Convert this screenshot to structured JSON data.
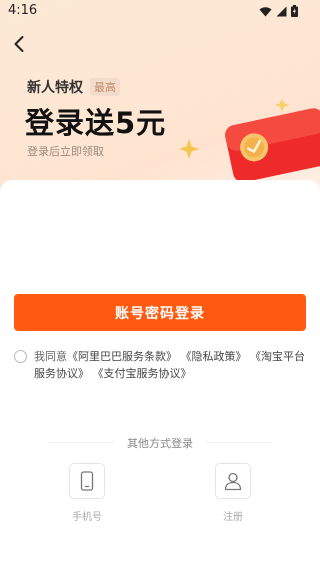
{
  "status_bar": {
    "time": "4:16",
    "icons": [
      "wifi-icon",
      "signal-icon",
      "battery-icon"
    ]
  },
  "header": {
    "back_icon": "chevron-left-icon"
  },
  "promo": {
    "subtitle": "新人特权",
    "badge": "最高",
    "title": "登录送5元",
    "hint": "登录后立即领取",
    "image": "red-packet-icon"
  },
  "login": {
    "button_label": "账号密码登录",
    "color": "#ff5a10"
  },
  "agreement": {
    "prefix": "我同意",
    "links": [
      "《阿里巴巴服务条款》",
      "《隐私政策》",
      "《淘宝平台服务协议》",
      "《支付宝服务协议》"
    ]
  },
  "other_login": {
    "title": "其他方式登录",
    "options": [
      {
        "label": "手机号",
        "icon": "phone-icon"
      },
      {
        "label": "注册",
        "icon": "user-icon"
      }
    ]
  }
}
